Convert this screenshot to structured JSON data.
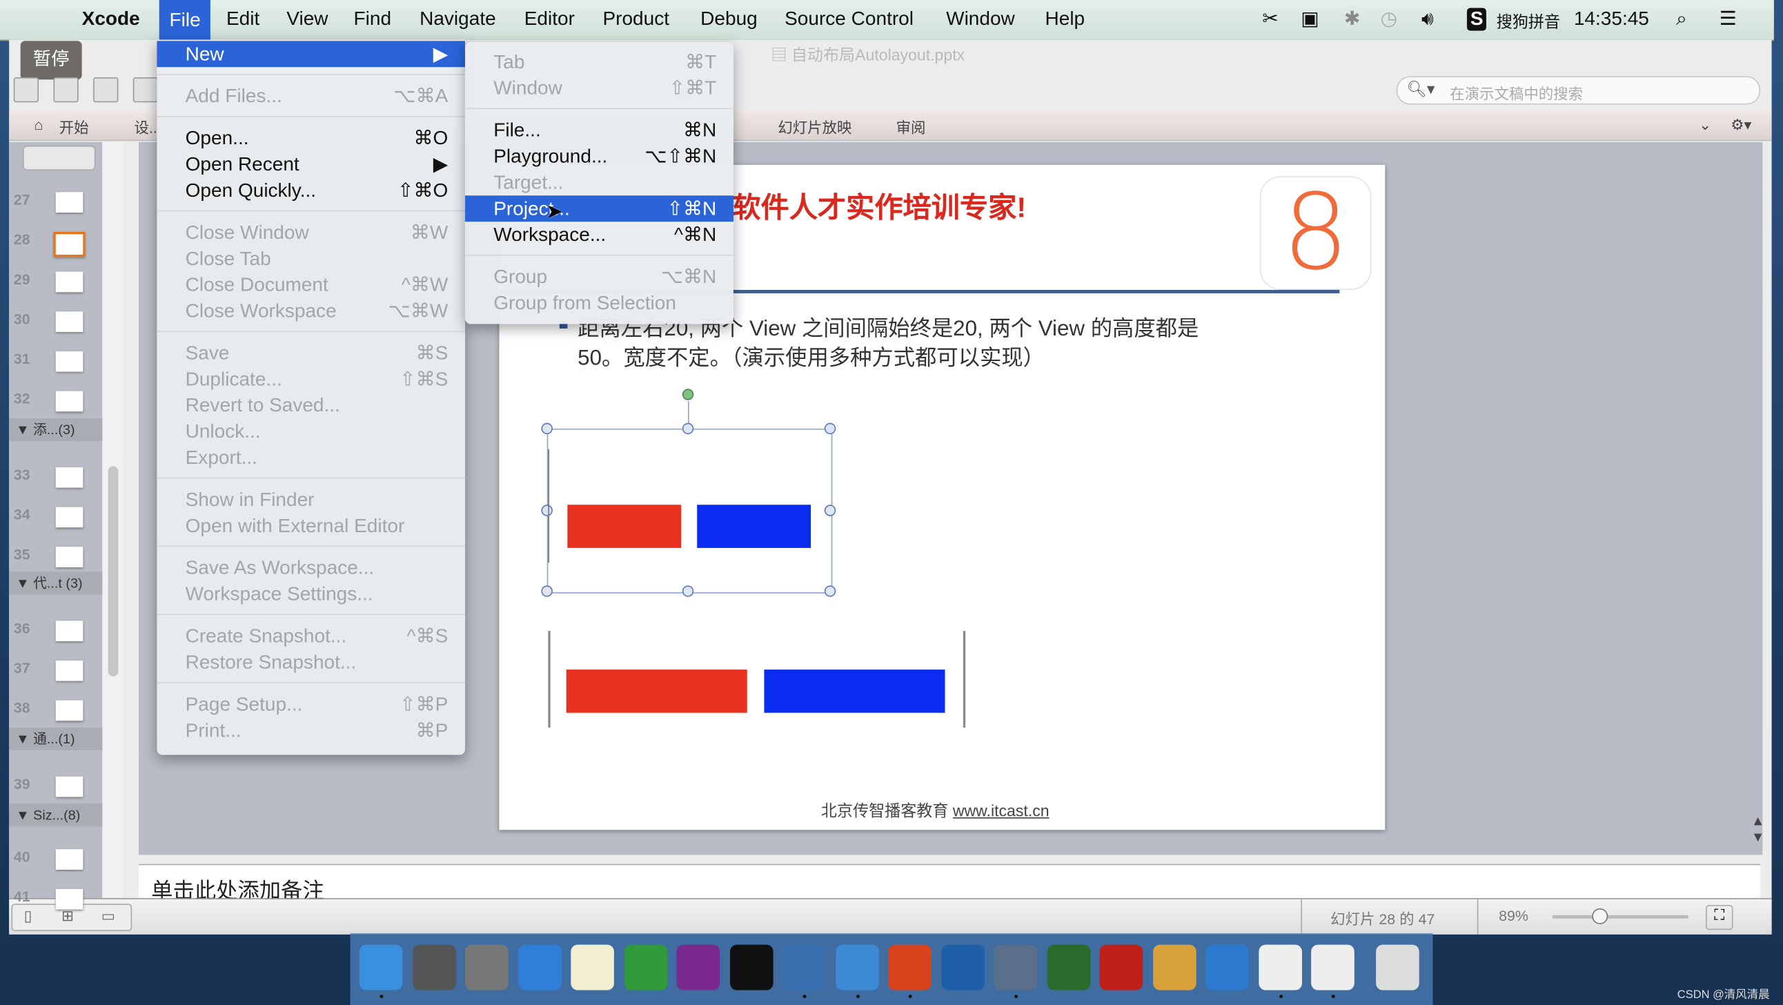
{
  "menubar": {
    "app": "Xcode",
    "items": [
      "File",
      "Edit",
      "View",
      "Find",
      "Navigate",
      "Editor",
      "Product",
      "Debug",
      "Source Control",
      "Window",
      "Help"
    ],
    "ime": "搜狗拼音",
    "clock": "14:35:45"
  },
  "toolbar": {
    "pause": "暂停",
    "doc_title": "自动布局Autolayout.pptx",
    "search_placeholder": "在演示文稿中的搜索"
  },
  "ribbon": {
    "tabs": [
      "开始",
      "设...",
      "幻灯片放映",
      "审阅"
    ]
  },
  "sidebar": {
    "slides_a": [
      "27",
      "28",
      "29",
      "30",
      "31",
      "32"
    ],
    "sections": [
      "添...(3)",
      "代...t (3)",
      "通...(1)",
      "Siz...(8)"
    ],
    "slides_b": [
      "33",
      "34",
      "35"
    ],
    "slides_c": [
      "36",
      "37",
      "38"
    ],
    "slides_d": [
      "39"
    ],
    "slides_e": [
      "40",
      "41"
    ],
    "current": "28"
  },
  "file_menu": [
    {
      "label": "New",
      "shortcut": "▶",
      "state": "highlighted"
    },
    {
      "sep": true
    },
    {
      "label": "Add Files...",
      "shortcut": "⌥⌘A",
      "state": "disabled"
    },
    {
      "sep": true
    },
    {
      "label": "Open...",
      "shortcut": "⌘O"
    },
    {
      "label": "Open Recent",
      "shortcut": "▶"
    },
    {
      "label": "Open Quickly...",
      "shortcut": "⇧⌘O"
    },
    {
      "sep": true
    },
    {
      "label": "Close Window",
      "shortcut": "⌘W",
      "state": "disabled"
    },
    {
      "label": "Close Tab",
      "shortcut": "",
      "state": "disabled"
    },
    {
      "label": "Close Document",
      "shortcut": "^⌘W",
      "state": "disabled"
    },
    {
      "label": "Close Workspace",
      "shortcut": "⌥⌘W",
      "state": "disabled"
    },
    {
      "sep": true
    },
    {
      "label": "Save",
      "shortcut": "⌘S",
      "state": "disabled"
    },
    {
      "label": "Duplicate...",
      "shortcut": "⇧⌘S",
      "state": "disabled"
    },
    {
      "label": "Revert to Saved...",
      "shortcut": "",
      "state": "disabled"
    },
    {
      "label": "Unlock...",
      "shortcut": "",
      "state": "disabled"
    },
    {
      "label": "Export...",
      "shortcut": "",
      "state": "disabled"
    },
    {
      "sep": true
    },
    {
      "label": "Show in Finder",
      "shortcut": "",
      "state": "disabled"
    },
    {
      "label": "Open with External Editor",
      "shortcut": "",
      "state": "disabled"
    },
    {
      "sep": true
    },
    {
      "label": "Save As Workspace...",
      "shortcut": "",
      "state": "disabled"
    },
    {
      "label": "Workspace Settings...",
      "shortcut": "",
      "state": "disabled"
    },
    {
      "sep": true
    },
    {
      "label": "Create Snapshot...",
      "shortcut": "^⌘S",
      "state": "disabled"
    },
    {
      "label": "Restore Snapshot...",
      "shortcut": "",
      "state": "disabled"
    },
    {
      "sep": true
    },
    {
      "label": "Page Setup...",
      "shortcut": "⇧⌘P",
      "state": "disabled"
    },
    {
      "label": "Print...",
      "shortcut": "⌘P",
      "state": "disabled"
    }
  ],
  "new_submenu": [
    {
      "label": "Tab",
      "shortcut": "⌘T",
      "state": "disabled"
    },
    {
      "label": "Window",
      "shortcut": "⇧⌘T",
      "state": "disabled"
    },
    {
      "sep": true
    },
    {
      "label": "File...",
      "shortcut": "⌘N"
    },
    {
      "label": "Playground...",
      "shortcut": "⌥⇧⌘N"
    },
    {
      "label": "Target...",
      "shortcut": "",
      "state": "disabled"
    },
    {
      "label": "Project...",
      "shortcut": "⇧⌘N",
      "state": "highlighted"
    },
    {
      "label": "Workspace...",
      "shortcut": "^⌘N"
    },
    {
      "sep": true
    },
    {
      "label": "Group",
      "shortcut": "⌥⌘N",
      "state": "disabled"
    },
    {
      "label": "Group from Selection",
      "shortcut": "",
      "state": "disabled"
    }
  ],
  "slide": {
    "title": "软件人才实作培训专家!",
    "bullet_line1": "距离左右20, 两个 View 之间间隔始终是20, 两个 View 的高度都是",
    "bullet_line2": "50。宽度不定。（演示使用多种方式都可以实现）",
    "footer": "北京传智播客教育",
    "footer_link": "www.itcast.cn",
    "logo": "8",
    "colors": {
      "red": "#e8321f",
      "blue": "#0a2cf0",
      "title": "#d9281e"
    }
  },
  "notes": {
    "placeholder": "单击此处添加备注"
  },
  "status": {
    "slide_counter": "幻灯片 28 的 47",
    "zoom": "89%",
    "zoom_level_percent": 89
  },
  "dock": {
    "apps": [
      "finder",
      "system-preferences",
      "launchpad",
      "safari",
      "notes",
      "excel",
      "onenote",
      "terminal",
      "xcode",
      "simulator",
      "powerpoint",
      "screenshot",
      "imovie",
      "ftp",
      "filezilla",
      "pages-draw",
      "word",
      "document-a",
      "document-b",
      "trash"
    ]
  },
  "watermark": "CSDN @清风清晨"
}
